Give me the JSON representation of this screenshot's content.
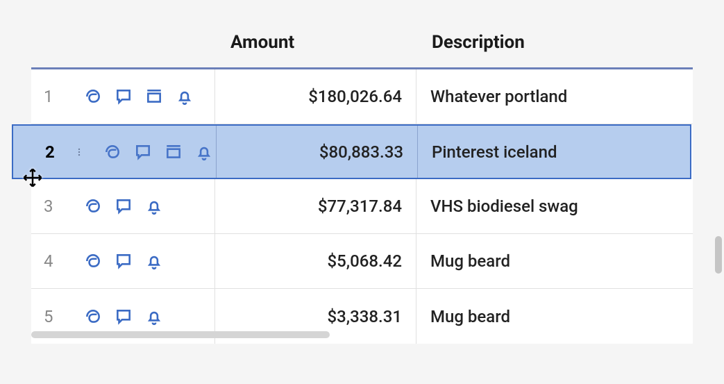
{
  "headers": {
    "amount": "Amount",
    "description": "Description"
  },
  "selected_row_index": 1,
  "rows": [
    {
      "num": "1",
      "amount": "$180,026.64",
      "description": "Whatever portland",
      "icons": [
        "attach",
        "comment",
        "archive",
        "bell"
      ]
    },
    {
      "num": "2",
      "amount": "$80,883.33",
      "description": "Pinterest iceland",
      "icons": [
        "attach",
        "comment",
        "archive",
        "bell"
      ]
    },
    {
      "num": "3",
      "amount": "$77,317.84",
      "description": "VHS biodiesel swag",
      "icons": [
        "attach",
        "comment",
        "bell"
      ]
    },
    {
      "num": "4",
      "amount": "$5,068.42",
      "description": "Mug beard",
      "icons": [
        "attach",
        "comment",
        "bell"
      ]
    },
    {
      "num": "5",
      "amount": "$3,338.31",
      "description": "Mug beard",
      "icons": [
        "attach",
        "comment",
        "bell"
      ]
    }
  ]
}
